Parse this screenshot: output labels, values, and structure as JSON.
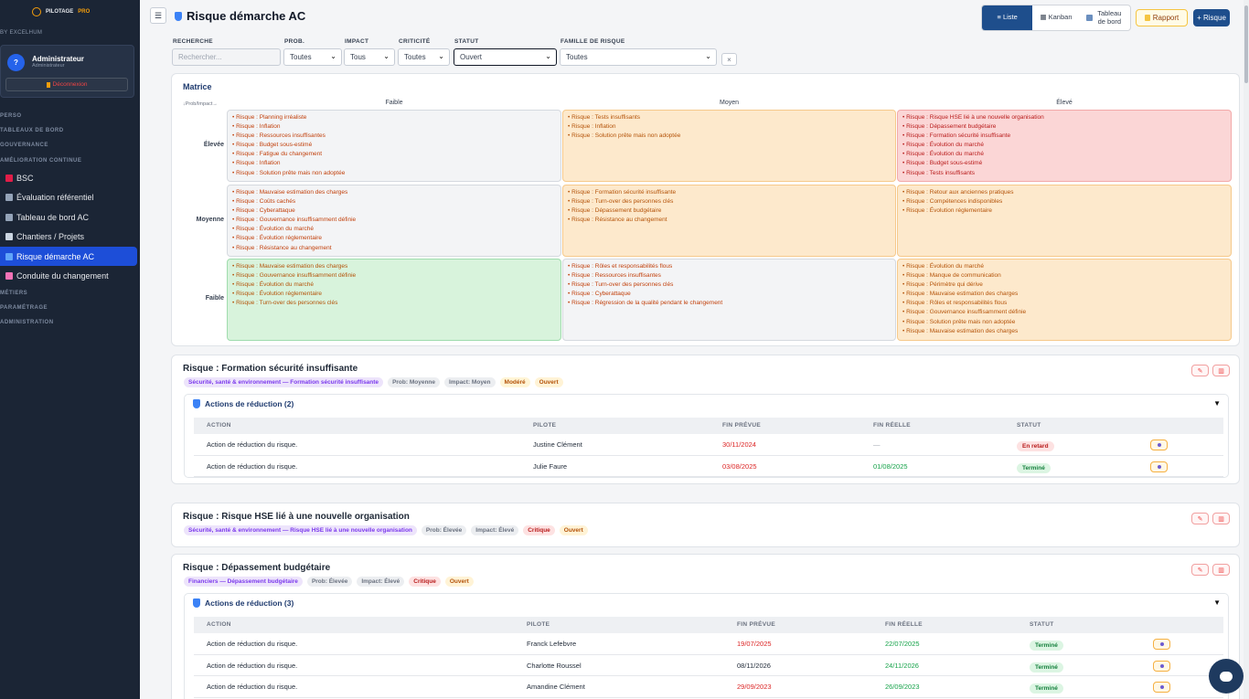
{
  "sidebar": {
    "brand": "PILOTAGE",
    "brand_pro": "PRO",
    "by": "BY EXCELHUM",
    "user": {
      "initial": "?",
      "name": "Administrateur",
      "role": "Administrateur",
      "logout": "Déconnexion"
    },
    "nav": [
      {
        "type": "sec",
        "label": "PERSO"
      },
      {
        "type": "sec",
        "label": "TABLEAUX DE BORD"
      },
      {
        "type": "sec",
        "label": "GOUVERNANCE"
      },
      {
        "type": "sec",
        "label": "AMÉLIORATION CONTINUE"
      },
      {
        "type": "item",
        "label": "BSC",
        "icon": "target-icon",
        "color": "#e11d48"
      },
      {
        "type": "item",
        "label": "Évaluation référentiel",
        "icon": "chart-icon",
        "color": "#94a3b8"
      },
      {
        "type": "item",
        "label": "Tableau de bord AC",
        "icon": "dashboard-icon",
        "color": "#94a3b8"
      },
      {
        "type": "item",
        "label": "Chantiers / Projets",
        "icon": "wrench-icon",
        "color": "#cbd5e1"
      },
      {
        "type": "item",
        "label": "Risque démarche AC",
        "icon": "shield-icon",
        "color": "#60a5fa",
        "active": true
      },
      {
        "type": "item",
        "label": "Conduite du changement",
        "icon": "megaphone-icon",
        "color": "#f472b6"
      },
      {
        "type": "sec",
        "label": "MÉTIERS"
      },
      {
        "type": "sec",
        "label": "PARAMÉTRAGE"
      },
      {
        "type": "sec",
        "label": "ADMINISTRATION"
      }
    ]
  },
  "header": {
    "menu_icon": "☰",
    "title": "Risque démarche AC",
    "views": {
      "list": "≡ Liste",
      "kanban": "▦ Kanban",
      "board": "Tableau de bord"
    },
    "report": "Rapport",
    "add": "+ Risque"
  },
  "filters": {
    "search": {
      "label": "RECHERCHE",
      "placeholder": "Rechercher..."
    },
    "prob": {
      "label": "PROB.",
      "value": "Toutes"
    },
    "impact": {
      "label": "IMPACT",
      "value": "Tous"
    },
    "crit": {
      "label": "CRITICITÉ",
      "value": "Toutes"
    },
    "statut": {
      "label": "STATUT",
      "value": "Ouvert"
    },
    "famille": {
      "label": "FAMILLE DE RISQUE",
      "value": "Toutes"
    },
    "clear": "×"
  },
  "matrix": {
    "title": "Matrice",
    "axis": "↓Prob/Impact→",
    "cols": [
      "Faible",
      "Moyen",
      "Élevé"
    ],
    "rows": [
      {
        "label": "Élevée",
        "cells": [
          [
            "Risque : Planning irréaliste",
            "Risque : Inflation",
            "Risque : Ressources insuffisantes",
            "Risque : Budget sous-estimé",
            "Risque : Fatigue du changement",
            "Risque : Inflation",
            "Risque : Solution prête mais non adoptée"
          ],
          [
            "Risque : Tests insuffisants",
            "Risque : Inflation",
            "Risque : Solution prête mais non adoptée"
          ],
          [
            "Risque : Risque HSE lié à une nouvelle organisation",
            "Risque : Dépassement budgétaire",
            "Risque : Formation sécurité insuffisante",
            "Risque : Évolution du marché",
            "Risque : Évolution du marché",
            "Risque : Budget sous-estimé",
            "Risque : Tests insuffisants"
          ]
        ]
      },
      {
        "label": "Moyenne",
        "cells": [
          [
            "Risque : Mauvaise estimation des charges",
            "Risque : Coûts cachés",
            "Risque : Cyberattaque",
            "Risque : Gouvernance insuffisamment définie",
            "Risque : Évolution du marché",
            "Risque : Évolution réglementaire",
            "Risque : Résistance au changement"
          ],
          [
            "Risque : Formation sécurité insuffisante",
            "Risque : Turn-over des personnes clés",
            "Risque : Dépassement budgétaire",
            "Risque : Résistance au changement"
          ],
          [
            "Risque : Retour aux anciennes pratiques",
            "Risque : Compétences indisponibles",
            "Risque : Évolution réglementaire"
          ]
        ]
      },
      {
        "label": "Faible",
        "cells": [
          [
            "Risque : Mauvaise estimation des charges",
            "Risque : Gouvernance insuffisamment définie",
            "Risque : Évolution du marché",
            "Risque : Évolution réglementaire",
            "Risque : Turn-over des personnes clés"
          ],
          [
            "Risque : Rôles et responsabilités flous",
            "Risque : Ressources insuffisantes",
            "Risque : Turn-over des personnes clés",
            "Risque : Cyberattaque",
            "Risque : Régression de la qualité pendant le changement"
          ],
          [
            "Risque : Évolution du marché",
            "Risque : Manque de communication",
            "Risque : Périmètre qui dérive",
            "Risque : Mauvaise estimation des charges",
            "Risque : Rôles et responsabilités flous",
            "Risque : Gouvernance insuffisamment définie",
            "Risque : Solution prête mais non adoptée",
            "Risque : Mauvaise estimation des charges"
          ]
        ]
      }
    ],
    "cell_colors": [
      [
        "gray",
        "orange",
        "red"
      ],
      [
        "gray",
        "orange",
        "orange"
      ],
      [
        "green",
        "gray",
        "orange"
      ]
    ]
  },
  "table_headers": [
    "ACTION",
    "PILOTE",
    "FIN PRÉVUE",
    "FIN RÉELLE",
    "STATUT"
  ],
  "risks": [
    {
      "title": "Risque : Formation sécurité insuffisante",
      "tags": [
        {
          "t": "Sécurité, santé & environnement — Formation sécurité insuffisante",
          "c": "t-fam"
        },
        {
          "t": "Prob: Moyenne",
          "c": "t-gray"
        },
        {
          "t": "Impact: Moyen",
          "c": "t-gray"
        },
        {
          "t": "Modéré",
          "c": "t-mod"
        },
        {
          "t": "Ouvert",
          "c": "t-open"
        }
      ],
      "actions_title": "Actions de réduction (2)",
      "rows": [
        {
          "action": "Action de réduction du risque.",
          "pilote": "Justine Clément",
          "prevue": "30/11/2024",
          "prevue_color": "red",
          "reelle": "—",
          "reelle_color": "gray",
          "statut": "En retard",
          "st": "st-late"
        },
        {
          "action": "Action de réduction du risque.",
          "pilote": "Julie Faure",
          "prevue": "03/08/2025",
          "prevue_color": "red",
          "reelle": "01/08/2025",
          "reelle_color": "grn",
          "statut": "Terminé",
          "st": "st-done"
        }
      ]
    },
    {
      "title": "Risque : Risque HSE lié à une nouvelle organisation",
      "tags": [
        {
          "t": "Sécurité, santé & environnement — Risque HSE lié à une nouvelle organisation",
          "c": "t-fam"
        },
        {
          "t": "Prob: Élevée",
          "c": "t-gray"
        },
        {
          "t": "Impact: Élevé",
          "c": "t-gray"
        },
        {
          "t": "Critique",
          "c": "t-crit"
        },
        {
          "t": "Ouvert",
          "c": "t-open"
        }
      ]
    },
    {
      "title": "Risque : Dépassement budgétaire",
      "tags": [
        {
          "t": "Financiers — Dépassement budgétaire",
          "c": "t-fam"
        },
        {
          "t": "Prob: Élevée",
          "c": "t-gray"
        },
        {
          "t": "Impact: Élevé",
          "c": "t-gray"
        },
        {
          "t": "Critique",
          "c": "t-crit"
        },
        {
          "t": "Ouvert",
          "c": "t-open"
        }
      ],
      "actions_title": "Actions de réduction (3)",
      "rows": [
        {
          "action": "Action de réduction du risque.",
          "pilote": "Franck Lefebvre",
          "prevue": "19/07/2025",
          "prevue_color": "red",
          "reelle": "22/07/2025",
          "reelle_color": "grn",
          "statut": "Terminé",
          "st": "st-done"
        },
        {
          "action": "Action de réduction du risque.",
          "pilote": "Charlotte Roussel",
          "prevue": "08/11/2026",
          "prevue_color": "dark",
          "reelle": "24/11/2026",
          "reelle_color": "grn",
          "statut": "Terminé",
          "st": "st-done"
        },
        {
          "action": "Action de réduction du risque.",
          "pilote": "Amandine Clément",
          "prevue": "29/09/2023",
          "prevue_color": "red",
          "reelle": "26/09/2023",
          "reelle_color": "grn",
          "statut": "Terminé",
          "st": "st-done"
        }
      ]
    }
  ]
}
